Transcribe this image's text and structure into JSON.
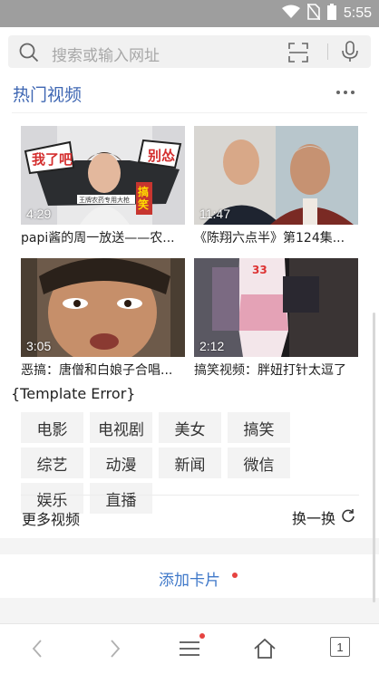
{
  "status_bar": {
    "time": "5:55",
    "icons": [
      "wifi-icon",
      "no-sim-icon",
      "battery-icon"
    ]
  },
  "search": {
    "placeholder": "搜索或输入网址",
    "icons": [
      "search-icon",
      "scan-icon",
      "mic-icon"
    ]
  },
  "card": {
    "title": "热门视频",
    "videos": [
      {
        "title": "papi酱的周一放送——农...",
        "duration": "4:29"
      },
      {
        "title": "《陈翔六点半》第124集...",
        "duration": "11:47"
      },
      {
        "title": "恶搞：唐僧和白娘子合唱...",
        "duration": "3:05"
      },
      {
        "title": "搞笑视频：胖妞打针太逗了",
        "duration": "2:12"
      }
    ],
    "thumb1_overlay": {
      "left": "我了吧",
      "right": "别怂",
      "side": "搞笑",
      "caption": "王牌农药专用大枪"
    },
    "thumb3_number": "33",
    "template_error": "{Template Error}",
    "tags": [
      "电影",
      "电视剧",
      "美女",
      "搞笑",
      "动漫",
      "新闻",
      "微信",
      "娱乐",
      "综艺",
      "直播"
    ],
    "more_videos": "更多视频",
    "refresh": "换一换"
  },
  "add_card": {
    "label": "添加卡片"
  },
  "bottom_nav": {
    "tab_count": "1",
    "icons": [
      "back-icon",
      "forward-icon",
      "menu-icon",
      "home-icon",
      "tabs-icon"
    ]
  },
  "colors": {
    "accent": "#3f67b3",
    "badge": "#e64340",
    "statusbar": "#9e9e9e"
  }
}
